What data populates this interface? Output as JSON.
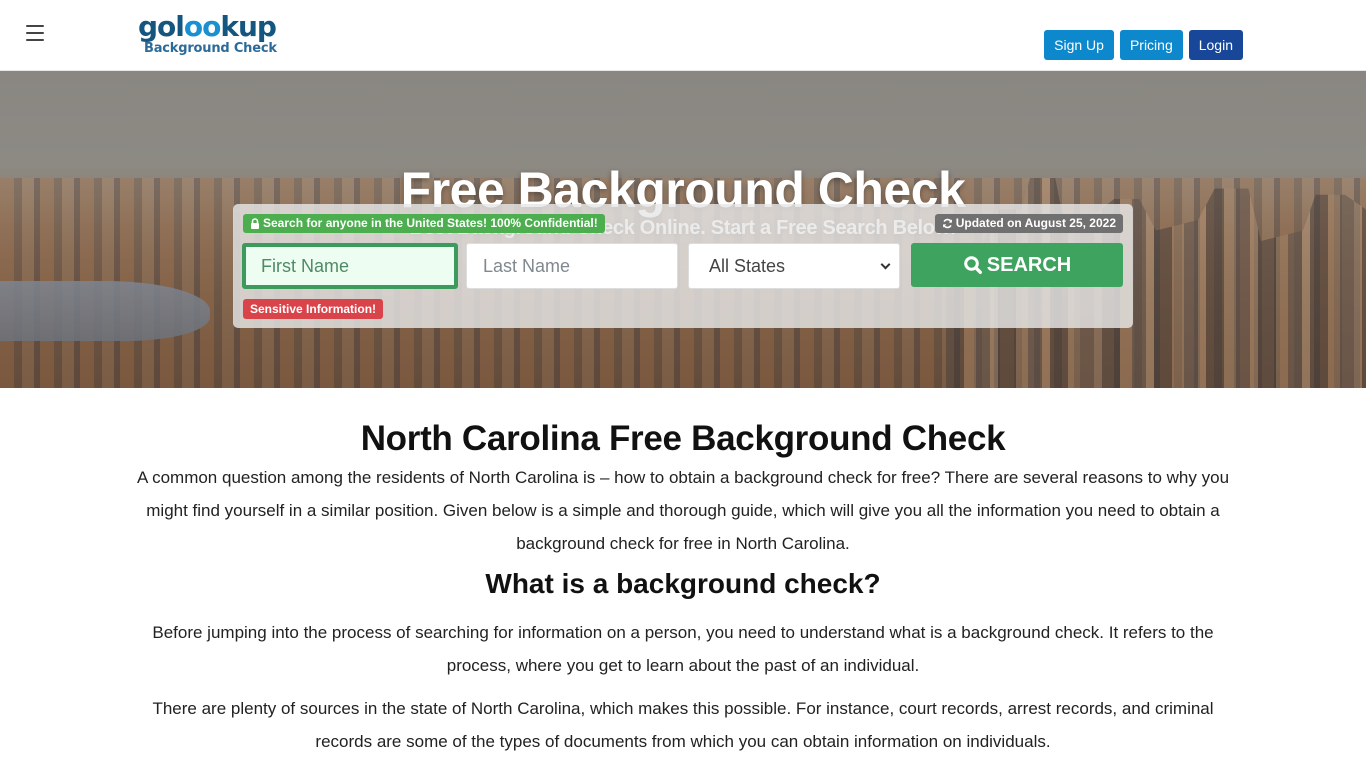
{
  "header": {
    "menu_icon": "hamburger-menu-icon",
    "logo": {
      "part1": "gol",
      "part2": "oo",
      "part3": "kup",
      "tagline": "Background Check"
    },
    "buttons": {
      "signup": "Sign Up",
      "pricing": "Pricing",
      "login": "Login"
    },
    "colors": {
      "signup": "#0e88cc",
      "pricing": "#0e88cc",
      "login": "#18479a"
    }
  },
  "hero": {
    "title": "Free Background Check",
    "subtitle": "Best Background Check Online. Start a Free Search Below!",
    "search": {
      "secure_badge": "Search for anyone in the United States! 100% Confidential!",
      "secure_icon": "lock-icon",
      "updated_badge": "Updated on August 25, 2022",
      "updated_icon": "refresh-icon",
      "first_name_placeholder": "First Name",
      "last_name_placeholder": "Last Name",
      "state_selected": "All States",
      "search_button": "SEARCH",
      "search_icon": "search-icon",
      "sensitive_badge": "Sensitive Information!"
    },
    "colors": {
      "search_button": "#3ea35e",
      "secure_badge": "#4cae4f",
      "sensitive_badge": "#d9434a",
      "updated_badge": "#707070"
    }
  },
  "content": {
    "heading": "North Carolina Free Background Check",
    "intro": "A common question among the residents of North Carolina is – how to obtain a background check for free? There are several reasons to why you might find yourself in a similar position. Given below is a simple and thorough guide, which will give you all the information you need to obtain a background check for free in North Carolina.",
    "subheading": "What is a background check?",
    "paragraphs": [
      "Before jumping into the process of searching for information on a person, you need to understand what is a background check. It refers to the process, where you get to learn about the past of an individual.",
      "There are plenty of sources in the state of North Carolina, which makes this possible. For instance, court records, arrest records, and criminal records are some of the types of documents from which you can obtain information on individuals."
    ]
  }
}
